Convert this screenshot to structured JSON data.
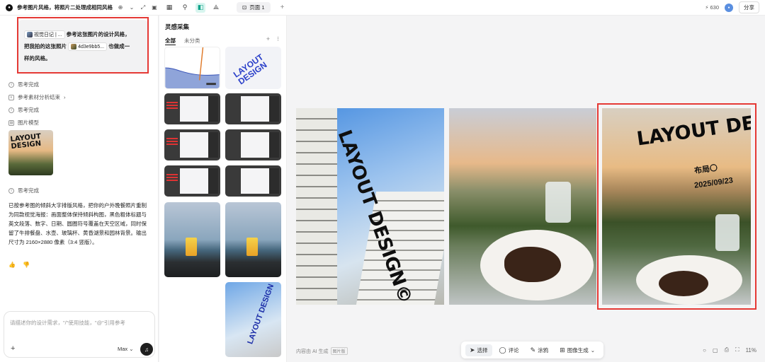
{
  "topbar": {
    "title": "参考图片风格，将照片二处理成相同风格",
    "tab_label": "页面 1",
    "credits": "630",
    "share_label": "分享"
  },
  "chat": {
    "message": {
      "chip1": "视觉日记 | ...",
      "text1": "参考这张图片的设计风格，",
      "text2": "把我拍的这张照片",
      "chip2": "4d3e9bb5...",
      "text3": "也做成一",
      "text4": "样的风格。"
    },
    "statuses": [
      "思考完成",
      "参考素材分析结束",
      "思考完成",
      "图片模型",
      "思考完成"
    ],
    "result_thumb_title": "LAYOUT DESIGN",
    "description": "已按参考图的倾斜大字排版风格，把你的户外晚餐照片重制为同款视觉海报：画面整体保持倾斜构图，黑色粗体标题与英文段落、数字、日期、圆圈符号覆盖在天空区域，同时保留了牛排餐盘、水壶、玻璃杯、黄昏湖景和园林背景。输出尺寸为 2160×2880 像素（3:4 竖版）。",
    "composer_placeholder": "请描述你的设计需求，\"/\"使用技能，\"@\"引用参考",
    "mode": "Max"
  },
  "inspiration": {
    "title": "灵感采集",
    "tabs": [
      "全部",
      "未分类"
    ],
    "poster_text": "LAYOUT DESIGN"
  },
  "canvas": {
    "poster1_title": "LAYOUT DESIGN©",
    "poster2_title": "LAYOUT DESIGN©",
    "poster2_sub": "布局〇",
    "poster2_date": "2025/09/23",
    "caption": "内容由 AI 生成",
    "caption_tag": "图片版",
    "toolbar": [
      "选择",
      "评论",
      "涂鸦",
      "图像生成"
    ],
    "zoom": "11%"
  },
  "colors": {
    "accent": "#10a38a",
    "highlight_frame": "#e53935",
    "poster_blue": "#2a3fc9"
  }
}
